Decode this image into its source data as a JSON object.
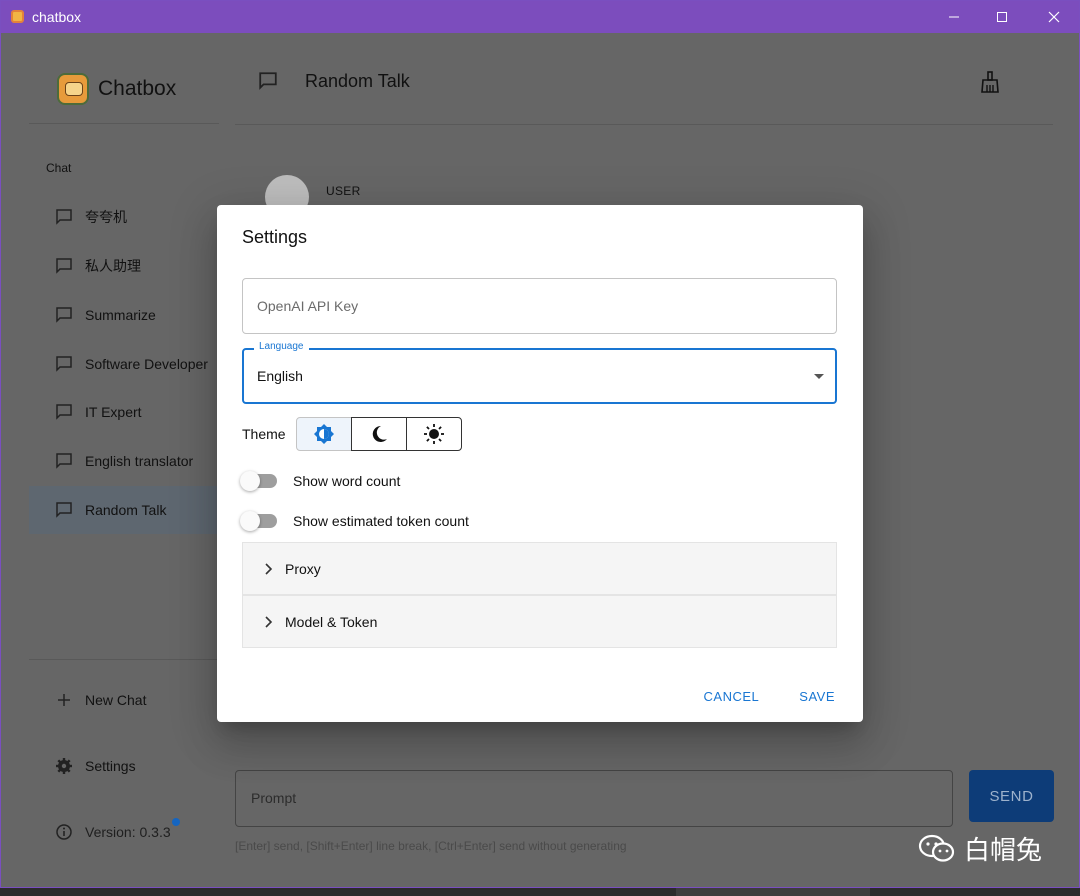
{
  "window": {
    "title": "chatbox"
  },
  "sidebar": {
    "brand": "Chatbox",
    "section_label": "Chat",
    "items": [
      {
        "label": "夸夸机",
        "selected": false
      },
      {
        "label": "私人助理",
        "selected": false
      },
      {
        "label": "Summarize",
        "selected": false
      },
      {
        "label": "Software Developer",
        "selected": false
      },
      {
        "label": "IT Expert",
        "selected": false
      },
      {
        "label": "English translator",
        "selected": false
      },
      {
        "label": "Random Talk",
        "selected": true
      }
    ],
    "new_chat": "New Chat",
    "settings": "Settings",
    "version": "Version: 0.3.3"
  },
  "main": {
    "title": "Random Talk",
    "message_role": "USER",
    "prompt_placeholder": "Prompt",
    "send_label": "SEND",
    "hint": "[Enter] send, [Shift+Enter] line break, [Ctrl+Enter] send without generating"
  },
  "dialog": {
    "title": "Settings",
    "api_key_placeholder": "OpenAI API Key",
    "language_label": "Language",
    "language_value": "English",
    "theme_label": "Theme",
    "theme_options": [
      "auto-theme-icon",
      "moon-icon",
      "sun-icon"
    ],
    "toggles": [
      {
        "label": "Show word count",
        "on": false
      },
      {
        "label": "Show estimated token count",
        "on": false
      }
    ],
    "accordions": [
      {
        "label": "Proxy"
      },
      {
        "label": "Model & Token"
      }
    ],
    "cancel": "CANCEL",
    "save": "SAVE"
  },
  "watermark": {
    "text": "白帽兔"
  },
  "colors": {
    "accent": "#1976d2",
    "titlebar": "#7c4dbd",
    "send": "#0d3c78"
  }
}
